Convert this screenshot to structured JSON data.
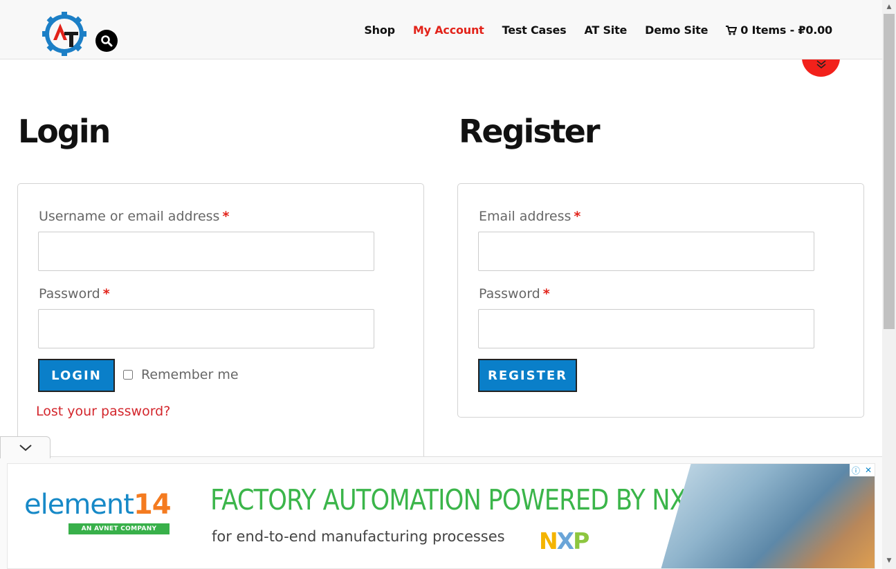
{
  "header": {
    "logo_icon": "gear-logo-icon",
    "search_icon": "search-icon",
    "nav": [
      {
        "label": "Shop",
        "active": false
      },
      {
        "label": "My Account",
        "active": true
      },
      {
        "label": "Test Cases",
        "active": false
      },
      {
        "label": "AT Site",
        "active": false
      },
      {
        "label": "Demo Site",
        "active": false
      }
    ],
    "cart_label": "0 Items - ₽0.00",
    "cart_icon": "cart-icon"
  },
  "login": {
    "title": "Login",
    "username_label": "Username or email address",
    "password_label": "Password",
    "required_mark": "*",
    "button": "LOGIN",
    "remember_label": "Remember me",
    "lost_password": "Lost your password?"
  },
  "register": {
    "title": "Register",
    "email_label": "Email address",
    "password_label": "Password",
    "required_mark": "*",
    "button": "REGISTER"
  },
  "ad": {
    "brand_main": "element",
    "brand_num": "14",
    "brand_tagline": "AN AVNET COMPANY",
    "headline": "FACTORY AUTOMATION POWERED BY NXP",
    "subline": "for end-to-end manufacturing processes",
    "partner_logo": "NXP",
    "info_icon": "info-icon",
    "close_icon": "close-icon"
  },
  "colors": {
    "accent_red": "#e2231a",
    "button_blue": "#0a7fc9",
    "ad_green": "#3bb54a",
    "brand_blue": "#1789c7"
  }
}
